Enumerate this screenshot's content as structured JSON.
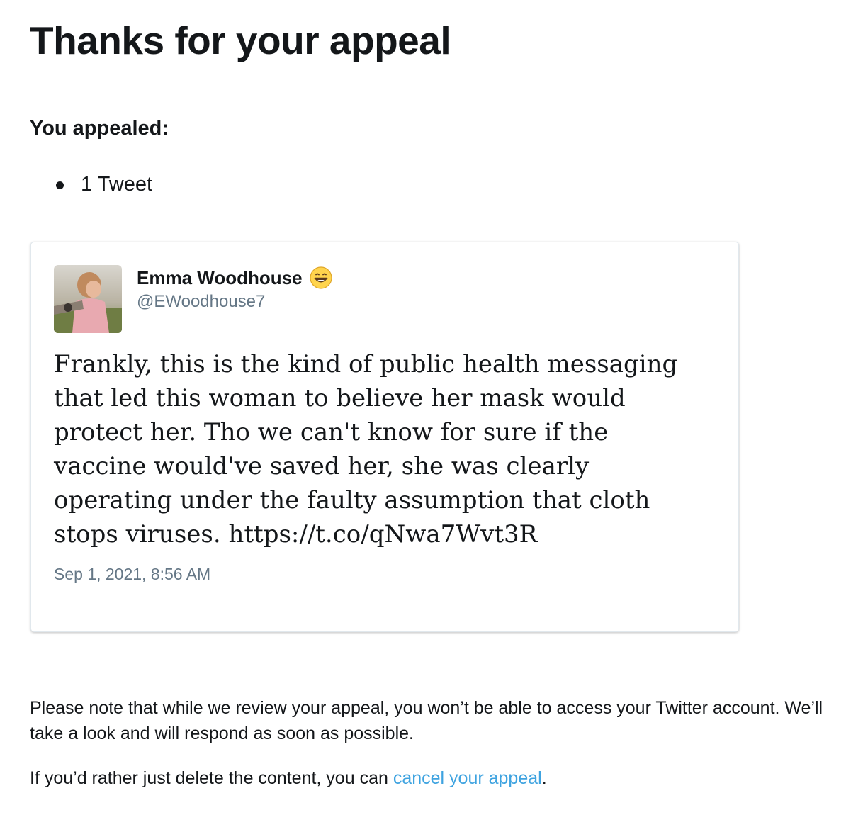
{
  "page": {
    "title": "Thanks for your appeal"
  },
  "appealed": {
    "heading": "You appealed:",
    "items": [
      "1 Tweet"
    ]
  },
  "tweet": {
    "author_name": "Emma Woodhouse",
    "author_emoji_icon": "grinning-face-emoji",
    "author_handle": "@EWoodhouse7",
    "text": "Frankly, this is the kind of public health messaging that led this woman to believe her mask would protect her. Tho we can't know for sure if the vaccine would've saved her, she was clearly operating under the faulty assumption that cloth stops viruses. https://t.co/qNwa7Wvt3R",
    "date": "Sep 1, 2021, 8:56 AM"
  },
  "notice": {
    "text": "Please note that while we review your appeal, you won’t be able to access your Twitter account. We’ll take a look and will respond as soon as possible."
  },
  "cancel": {
    "prefix": "If you’d rather just delete the content, you can ",
    "link_text": "cancel your appeal",
    "suffix": "."
  },
  "colors": {
    "text": "#14171a",
    "secondary_text": "#657786",
    "link": "#3ea3e0",
    "card_border": "#e1e8ed"
  }
}
